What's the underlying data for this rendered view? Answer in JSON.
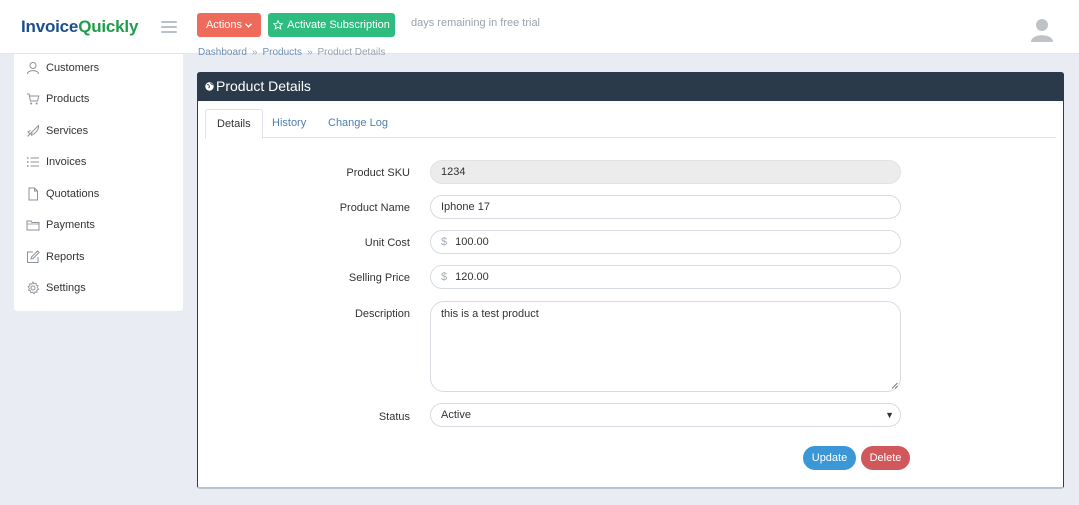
{
  "brand": {
    "part1": "Invoice",
    "part2": "Quickly"
  },
  "header": {
    "actions_label": "Actions",
    "activate_label": "Activate Subscription",
    "trial_text": "days remaining in free trial"
  },
  "sidebar": {
    "items": [
      {
        "label": "Customers",
        "icon": "user-icon"
      },
      {
        "label": "Products",
        "icon": "cart-icon"
      },
      {
        "label": "Services",
        "icon": "rocket-icon"
      },
      {
        "label": "Invoices",
        "icon": "list-icon"
      },
      {
        "label": "Quotations",
        "icon": "document-icon"
      },
      {
        "label": "Payments",
        "icon": "folder-icon"
      },
      {
        "label": "Reports",
        "icon": "edit-icon"
      },
      {
        "label": "Settings",
        "icon": "gear-icon"
      }
    ]
  },
  "breadcrumb": {
    "items": [
      "Dashboard",
      "Products",
      "Product Details"
    ]
  },
  "panel": {
    "title": "Product Details",
    "tabs": [
      "Details",
      "History",
      "Change Log"
    ]
  },
  "form": {
    "sku_label": "Product SKU",
    "sku_value": "1234",
    "name_label": "Product Name",
    "name_value": "Iphone 17",
    "unit_cost_label": "Unit Cost",
    "unit_cost_value": "100.00",
    "selling_price_label": "Selling Price",
    "selling_price_value": "120.00",
    "currency_symbol": "$",
    "description_label": "Description",
    "description_value": "this is a test product",
    "status_label": "Status",
    "status_value": "Active",
    "update_label": "Update",
    "delete_label": "Delete"
  },
  "colors": {
    "actions_button": "#ee6b5c",
    "activate_button": "#2ebd7e",
    "panel_header": "#2b3a4b",
    "update_button": "#3b97d6",
    "delete_button": "#d0585c",
    "link": "#4d7fb5"
  }
}
